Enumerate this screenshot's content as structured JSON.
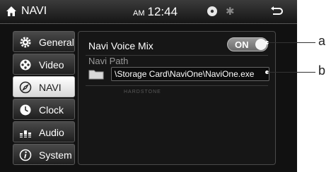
{
  "statusbar": {
    "title": "NAVI",
    "ampm": "AM",
    "time": "12:44",
    "icons": [
      "home-icon",
      "disc-icon",
      "bluetooth-icon",
      "back-icon"
    ]
  },
  "sidebar": {
    "items": [
      {
        "label": "General",
        "icon": "gear-icon",
        "active": false
      },
      {
        "label": "Video",
        "icon": "film-reel-icon",
        "active": false
      },
      {
        "label": "NAVI",
        "icon": "compass-icon",
        "active": true
      },
      {
        "label": "Clock",
        "icon": "clock-icon",
        "active": false
      },
      {
        "label": "Audio",
        "icon": "equalizer-icon",
        "active": false
      },
      {
        "label": "System",
        "icon": "info-icon",
        "active": false
      }
    ]
  },
  "content": {
    "voice_mix_label": "Navi Voice Mix",
    "voice_mix_toggle": "ON",
    "navi_path_label": "Navi Path",
    "navi_path_value": "\\Storage Card\\NaviOne\\NaviOne.exe",
    "watermark": "HARDSTONE"
  },
  "callouts": {
    "a": "a",
    "b": "b"
  },
  "colors": {
    "active_item_bg": "#ffffff",
    "toggle_bg": "#8a8a8a",
    "screen_bg": "#111111"
  }
}
